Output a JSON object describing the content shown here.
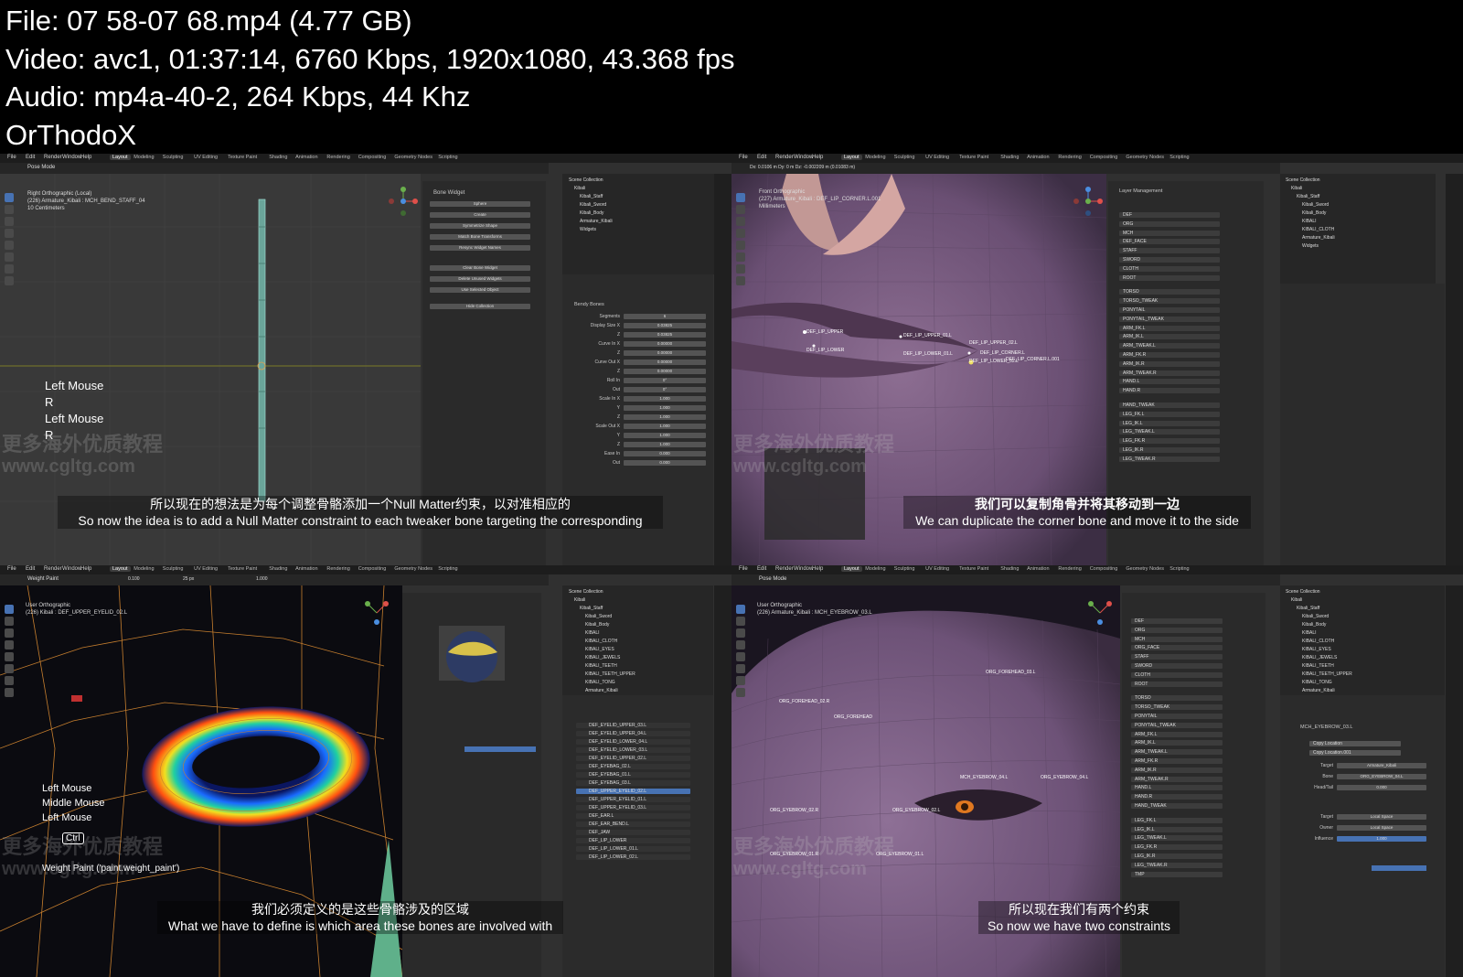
{
  "header": {
    "file_line": "File: 07 58-07 68.mp4 (4.77 GB)",
    "video_line": "Video: avc1, 01:37:14, 6760 Kbps, 1920x1080, 43.368 fps",
    "audio_line": "Audio: mp4a-40-2, 264 Kbps, 44 Khz",
    "author_line": "OrThodoX"
  },
  "menu": [
    "File",
    "Edit",
    "Render",
    "Window",
    "Help"
  ],
  "workspace_tabs": [
    "Layout",
    "Modeling",
    "Sculpting",
    "UV Editing",
    "Texture Paint",
    "Shading",
    "Animation",
    "Rendering",
    "Compositing",
    "Geometry Nodes",
    "Scripting"
  ],
  "watermark": {
    "cn": "更多海外优质教程",
    "url": "www.cgltg.com"
  },
  "panels": [
    {
      "id": "top-left",
      "mode": "Pose Mode",
      "viewport_lines": [
        "Right Orthographic (Local)",
        "(226) Armature_Kibali : MCH_BEND_STAFF_04",
        "10 Centimeters"
      ],
      "keys": [
        "Left Mouse",
        "R",
        "Left Mouse",
        "R"
      ],
      "sub_cn": "所以现在的想法是为每个调整骨骼添加一个Null Matter约束，以对准相应的",
      "sub_en": "So now the idea is to add a Null Matter constraint to each tweaker bone targeting the corresponding",
      "side_title": "Bone Widget",
      "side_items": [
        "Sphere",
        "Create",
        "Symmetrize Shape",
        "Match Bone Transforms",
        "Resync Widget Names",
        "Clear Bone Widget",
        "Delete Unused Widgets",
        "Use Selected Object",
        "Hide Collection"
      ],
      "props_title": "Bendy Bones",
      "props_rows": [
        {
          "label": "Segments",
          "value": "6"
        },
        {
          "label": "Display Size X",
          "value": "0.03825"
        },
        {
          "label": "Z",
          "value": "0.03825"
        },
        {
          "label": "Curve In X",
          "value": "0.00000"
        },
        {
          "label": "Z",
          "value": "0.00000"
        },
        {
          "label": "Curve Out X",
          "value": "0.00000"
        },
        {
          "label": "Z",
          "value": "0.00000"
        },
        {
          "label": "Roll In",
          "value": "0°"
        },
        {
          "label": "Out",
          "value": "0°"
        },
        {
          "label": "Scale In X",
          "value": "1.000"
        },
        {
          "label": "Y",
          "value": "1.000"
        },
        {
          "label": "Z",
          "value": "1.000"
        },
        {
          "label": "Scale Out X",
          "value": "1.000"
        },
        {
          "label": "Y",
          "value": "1.000"
        },
        {
          "label": "Z",
          "value": "1.000"
        },
        {
          "label": "Ease In",
          "value": "0.000"
        },
        {
          "label": "Out",
          "value": "0.000"
        }
      ],
      "outliner": [
        "Scene Collection",
        "Kibali",
        "Kibali_Staff",
        "Kibali_Sword",
        "Kibali_Body",
        "Armature_Kibali",
        "Widgets"
      ]
    },
    {
      "id": "top-right",
      "mode": "Pose Mode",
      "viewport_lines": [
        "Front Orthographic",
        "(227) Armature_Kibali : DEF_LIP_CORNER.L.001",
        "Millimeters"
      ],
      "header_info": "Dx: 0.0106 m  Dy: 0 m  Dz: -0.002209 m (0.01083 m)",
      "sub_cn": "我们可以复制角骨并将其移动到一边",
      "sub_en": "We can duplicate the corner bone and move it to the side",
      "bone_labels": [
        "DEF_LIP_UPPER",
        "DEF_LIP_LOWER",
        "DEF_LIP_UPPER_01.L",
        "DEF_LIP_LOWER_01.L",
        "DEF_LIP_UPPER_02.L",
        "DEF_LIP_CORNER.L",
        "DEF_LIP_LOWER_02.L",
        "DEF_LIP_CORNER.L.001"
      ],
      "layer_title": "Layer Management",
      "layers": [
        "DEF",
        "ORG",
        "MCH",
        "DEF_FACE",
        "STAFF",
        "SWORD",
        "CLOTH",
        "ROOT",
        "TORSO",
        "TORSO_TWEAK",
        "PONYTAIL",
        "PONYTAIL_TWEAK",
        "ARM_FK.L",
        "ARM_IK.L",
        "ARM_TWEAK.L",
        "ARM_FK.R",
        "ARM_IK.R",
        "ARM_TWEAK.R",
        "HAND.L",
        "HAND.R",
        "HAND_TWEAK",
        "LEG_FK.L",
        "LEG_IK.L",
        "LEG_TWEAK.L",
        "LEG_FK.R",
        "LEG_IK.R",
        "LEG_TWEAK.R"
      ],
      "outliner": [
        "Scene Collection",
        "Kibali",
        "Kibali_Staff",
        "Kibali_Sword",
        "Kibali_Body",
        "KIBALI",
        "KIBALI_CLOTH",
        "Armature_Kibali",
        "Widgets"
      ]
    },
    {
      "id": "bottom-left",
      "mode": "Weight Paint",
      "viewport_lines": [
        "User Orthographic",
        "(226) Kibali : DEF_UPPER_EYELID_02.L"
      ],
      "keys": [
        "Left Mouse",
        "Middle Mouse",
        "Left Mouse"
      ],
      "ctrl_key": "Ctrl",
      "status": "Weight Paint ('paint.weight_paint')",
      "sub_cn": "我们必须定义的是这些骨骼涉及的区域",
      "sub_en": "What we have to define is which area these bones are involved with",
      "brush_weight": "0.100",
      "brush_radius": "25 px",
      "brush_strength": "1.000",
      "vertex_groups": [
        "DEF_EYELID_UPPER_03.L",
        "DEF_EYELID_UPPER_04.L",
        "DEF_EYELID_LOWER_04.L",
        "DEF_EYELID_LOWER_03.L",
        "DEF_EYELID_UPPER_02.L",
        "DEF_EYEBAG_02.L",
        "DEF_EYEBAG_01.L",
        "DEF_EYEBAG_03.L",
        "DEF_UPPER_EYELID_02.L",
        "DEF_UPPER_EYELID_01.L",
        "DEF_UPPER_EYELID_03.L",
        "DEF_EAR.L",
        "DEF_EAR_BEND.L",
        "DEF_JAW",
        "DEF_LIP_LOWER",
        "DEF_LIP_LOWER_01.L",
        "DEF_LIP_LOWER_02.L"
      ],
      "outliner": [
        "Scene Collection",
        "Kibali",
        "Kibali_Staff",
        "Kibali_Sword",
        "Kibali_Body",
        "KIBALI",
        "KIBALI_CLOTH",
        "KIBALI_EYES",
        "KIBALI_JEWELS",
        "KIBALI_TEETH",
        "KIBALI_TEETH_UPPER",
        "KIBALI_TONG",
        "Armature_Kibali"
      ]
    },
    {
      "id": "bottom-right",
      "mode": "Pose Mode",
      "viewport_lines": [
        "User Orthographic",
        "(226) Armature_Kibali : MCH_EYEBROW_03.L"
      ],
      "sub_cn": "所以现在我们有两个约束",
      "sub_en": "So now we have two constraints",
      "bone_labels": [
        "ORG_FOREHEAD_03.L",
        "ORG_FOREHEAD_02.R",
        "ORG_FOREHEAD",
        "MCH_EYEBROW_04.L",
        "ORG_EYEBROW_04.L",
        "ORG_EYEBROW_02.R",
        "ORG_EYEBROW_02.L",
        "ORG_EYEBROW_01.R",
        "ORG_EYEBROW_01.L"
      ],
      "constraints": [
        "Copy Location",
        "Copy Location.001"
      ],
      "constraint_fields": [
        {
          "label": "Target",
          "value": "Armature_Kibali"
        },
        {
          "label": "Bone",
          "value": "ORG_EYEBROW_04.L"
        },
        {
          "label": "Head/Tail",
          "value": "0.000"
        },
        {
          "label": "Target",
          "value": "Local Space"
        },
        {
          "label": "Owner",
          "value": "Local Space"
        },
        {
          "label": "Influence",
          "value": "1.000"
        }
      ],
      "constraint_header": "MCH_EYEBROW_03.L",
      "layers": [
        "DEF",
        "ORG",
        "MCH",
        "ORG_FACE",
        "STAFF",
        "SWORD",
        "CLOTH",
        "ROOT",
        "TORSO",
        "TORSO_TWEAK",
        "PONYTAIL",
        "PONYTAIL_TWEAK",
        "ARM_FK.L",
        "ARM_IK.L",
        "ARM_TWEAK.L",
        "ARM_FK.R",
        "ARM_IK.R",
        "ARM_TWEAK.R",
        "HAND.L",
        "HAND.R",
        "HAND_TWEAK",
        "LEG_FK.L",
        "LEG_IK.L",
        "LEG_TWEAK.L",
        "LEG_FK.R",
        "LEG_IK.R",
        "LEG_TWEAK.R",
        "TMP"
      ],
      "outliner": [
        "Scene Collection",
        "Kibali",
        "Kibali_Staff",
        "Kibali_Sword",
        "Kibali_Body",
        "KIBALI",
        "KIBALI_CLOTH",
        "KIBALI_EYES",
        "KIBALI_JEWELS",
        "KIBALI_TEETH",
        "KIBALI_TEETH_UPPER",
        "KIBALI_TONG",
        "Armature_Kibali"
      ]
    }
  ],
  "colors": {
    "bg": "#000000",
    "ui_dark": "#1d1d1d",
    "ui_panel": "#2b2b2b",
    "viewport": "#3a3a3a",
    "accent": "#4772b3",
    "skin": "#7d5e86",
    "wire": "#d8922e"
  }
}
